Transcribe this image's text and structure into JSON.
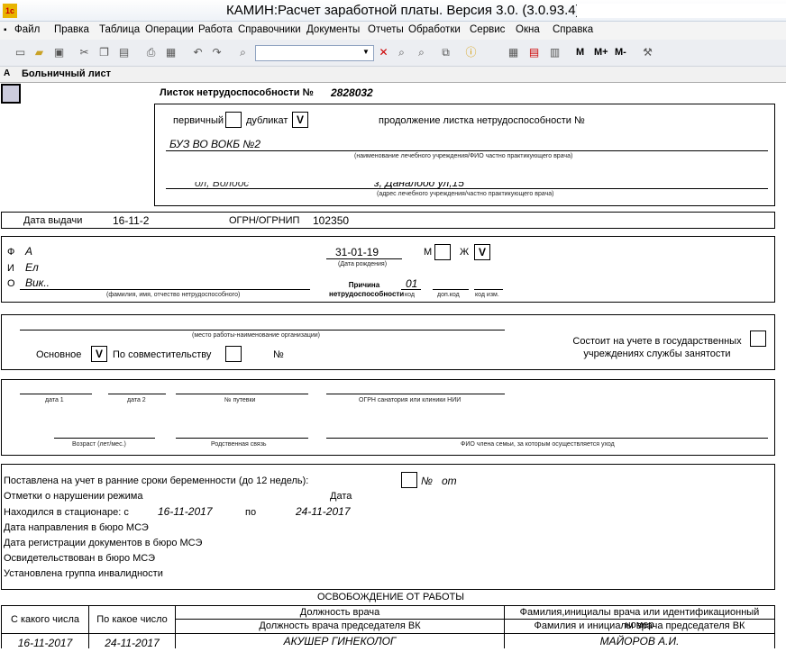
{
  "app": {
    "title": "КАМИН:Расчет заработной платы. Версия 3.0. (3.0.93.4)"
  },
  "menu": [
    "Файл",
    "Правка",
    "Таблица",
    "Операции",
    "Работа",
    "Справочники",
    "Документы",
    "Отчеты",
    "Обработки",
    "Сервис",
    "Окна",
    "Справка"
  ],
  "toolbar": {
    "m": "M",
    "mplus": "M+",
    "mminus": "M-"
  },
  "doc": {
    "title": "Больничный лист"
  },
  "sheet": {
    "header": "Листок нетрудоспособности №",
    "number": "2828032",
    "primary": "первичный",
    "duplicate": "дубликат",
    "duplicate_mark": "V",
    "continuation": "продолжение листка нетрудоспособности №",
    "institution": "БУЗ ВО ВОКБ №2",
    "institution_caption": "(наименование лечебного учреждения/ФИО частно практикующего врача)",
    "address_left": "ол, Волоос",
    "address_right": "з, Даналоод ул,15",
    "address_caption": "(адрес лечебного учреждения/частно практикующего врача)",
    "issue_label": "Дата выдачи",
    "issue_date": "16-11-2",
    "ogrn_label": "ОГРН/ОГРНИП",
    "ogrn": "102350",
    "f": "Ф",
    "i": "И",
    "o": "О",
    "surname": "А",
    "name": "Ел",
    "patronymic": "Вик..",
    "fio_caption": "(фамилия, имя, отчество нетрудоспособного)",
    "birth": "31-01-19",
    "birth_caption": "(Дата рождения)",
    "m": "М",
    "zh": "Ж",
    "gender_mark": "V",
    "cause": "Причина нетрудоспособности",
    "code_value": "01",
    "code": "код",
    "addcode": "доп.код",
    "changecode": "код изм.",
    "work_caption": "(место работы-наименование организации)",
    "employment_label": "Состоит на учете в государственных учреждениях службы занятости",
    "main": "Основное",
    "main_mark": "V",
    "part": "По совместительству",
    "num": "№",
    "date1": "дата 1",
    "date2": "дата 2",
    "voucher": "№ путевки",
    "sanatorium": "ОГРН санатория или клиники НИИ",
    "age": "Возраст (лет/мес.)",
    "relation": "Родственная связь",
    "family": "ФИО члена семьи, за которым осуществляется уход",
    "pregnancy": "Поставлена на учет в ранние сроки беременности (до 12 недель):",
    "pregnancy_num": "№",
    "pregnancy_from": "от",
    "violation": "Отметки о нарушении режима",
    "date_label": "Дата",
    "hospital": "Находился в стационаре: с",
    "hosp_from": "16-11-2017",
    "hosp_to_label": "по",
    "hosp_to": "24-11-2017",
    "mse_dir": "Дата направления в бюро МСЭ",
    "mse_reg": "Дата регистрации документов в бюро МСЭ",
    "mse_exam": "Освидетельствован в бюро МСЭ",
    "disability": "Установлена группа инвалидности",
    "release": "ОСВОБОЖДЕНИЕ ОТ РАБОТЫ",
    "from_col": "С какого числа",
    "to_col": "По какое число",
    "position_col": "Должность врача",
    "name_col": "Фамилия,инициалы врача или идентификационный номер",
    "vk_position": "Должность врача председателя ВК",
    "vk_name": "Фамилия и инициалы врача председателя ВК",
    "row_from": "16-11-2017",
    "row_to": "24-11-2017",
    "row_position": "АКУШЕР ГИНЕКОЛОГ",
    "row_name": "МАЙОРОВ А.И."
  }
}
